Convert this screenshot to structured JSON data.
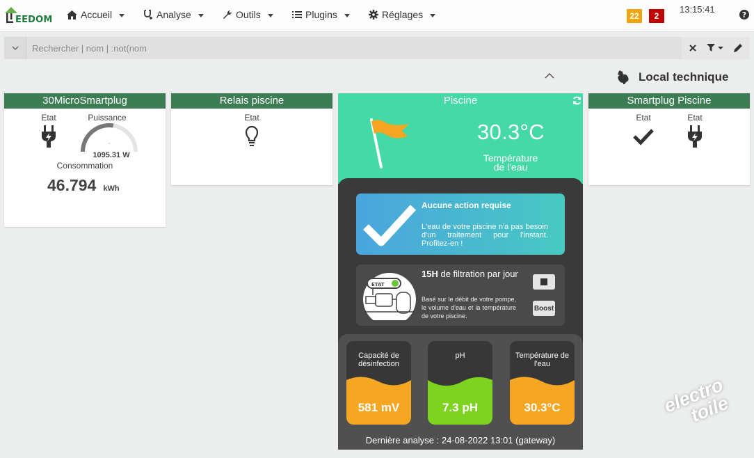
{
  "logo": {
    "brand_text": "EEDOM"
  },
  "nav": {
    "items": [
      {
        "label": "Accueil",
        "icon": "home-icon"
      },
      {
        "label": "Analyse",
        "icon": "stethoscope-icon"
      },
      {
        "label": "Outils",
        "icon": "wrench-icon"
      },
      {
        "label": "Plugins",
        "icon": "tasks-icon"
      },
      {
        "label": "Réglages",
        "icon": "gear-icon"
      }
    ],
    "badge_warning": "22",
    "badge_danger": "2",
    "time": "13:15:41"
  },
  "search": {
    "placeholder": "Rechercher | nom | :not(nom"
  },
  "object": {
    "title": "Local technique",
    "icon": "rooster-icon"
  },
  "widgets": {
    "microsmartplug": {
      "title": "30MicroSmartplug",
      "etat_label": "Etat",
      "puissance_label": "Puissance",
      "puissance_value": "1095.31 W",
      "gauge_fraction": 0.55,
      "consommation_label": "Consommation",
      "consommation_value": "46.794",
      "consommation_unit": "kWh"
    },
    "relais": {
      "title": "Relais piscine",
      "etat_label": "Etat"
    },
    "smartplug": {
      "title": "Smartplug Piscine",
      "etat1_label": "Etat",
      "etat2_label": "Etat"
    },
    "piscine": {
      "title": "Piscine",
      "temperature": "30.3°C",
      "temperature_label_1": "Température",
      "temperature_label_2": "de l'eau",
      "status_title": "Aucune action requise",
      "status_message": "L'eau de votre piscine n'a pas besoin d'un traitement pour l'instant. Profitez-en !",
      "filtration_hours": "15H",
      "filtration_text": "de filtration par jour",
      "filtration_desc": "Basé sur le débit de votre pompe, le volume d'eau et la température de votre piscine.",
      "etat_tag": "ETAT",
      "boost_label": "Boost",
      "metrics": [
        {
          "label": "Capacité de désinfection",
          "value": "581 mV",
          "color": "#f5a623"
        },
        {
          "label": "pH",
          "value": "7.3 pH",
          "color": "#7ed321"
        },
        {
          "label": "Température de l'eau",
          "value": "30.3°C",
          "color": "#f5a623"
        }
      ],
      "last_analysis": "Dernière analyse : 24-08-2022 13:01 (gateway)"
    }
  },
  "watermark": {
    "line1": "electro",
    "line2": "toile"
  },
  "colors": {
    "header_green": "#3c7d53",
    "pool_teal": "#45d9a8",
    "warning": "#f0a30a",
    "danger": "#c00000"
  }
}
